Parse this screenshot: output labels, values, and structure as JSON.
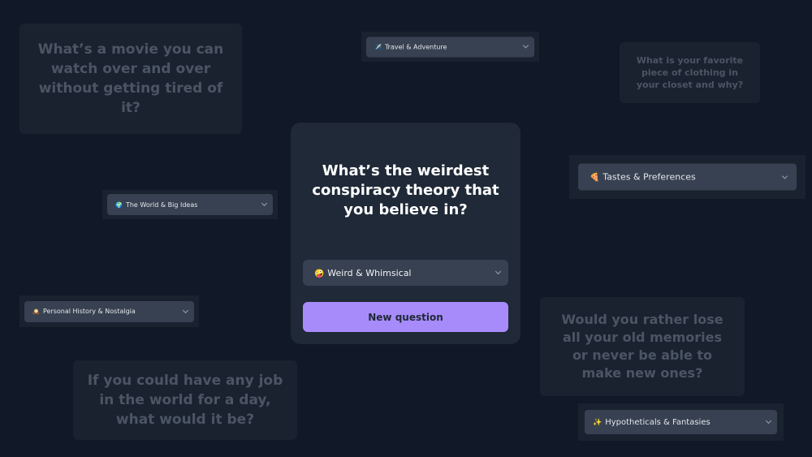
{
  "main": {
    "question": "What’s the weirdest conspiracy theory that you believe in?",
    "category": {
      "emoji": "🤪",
      "label": "Weird & Whimsical"
    },
    "new_question_label": "New question"
  },
  "background_questions": [
    {
      "text": "What’s a movie you can watch over and over without getting tired of it?"
    },
    {
      "text": "What is your favorite piece of clothing in your closet and why?"
    },
    {
      "text": "Would you rather lose all your old memories or never be able to make new ones?"
    },
    {
      "text": "If you could have any job in the world for a day, what would it be?"
    }
  ],
  "background_selects": [
    {
      "emoji": "✈️",
      "label": "Travel & Adventure"
    },
    {
      "emoji": "🍕",
      "label": "Tastes & Preferences"
    },
    {
      "emoji": "🌍",
      "label": "The World & Big Ideas"
    },
    {
      "emoji": "🕰️",
      "label": "Personal History & Nostalgia"
    },
    {
      "emoji": "✨",
      "label": "Hypotheticals & Fantasies"
    }
  ]
}
